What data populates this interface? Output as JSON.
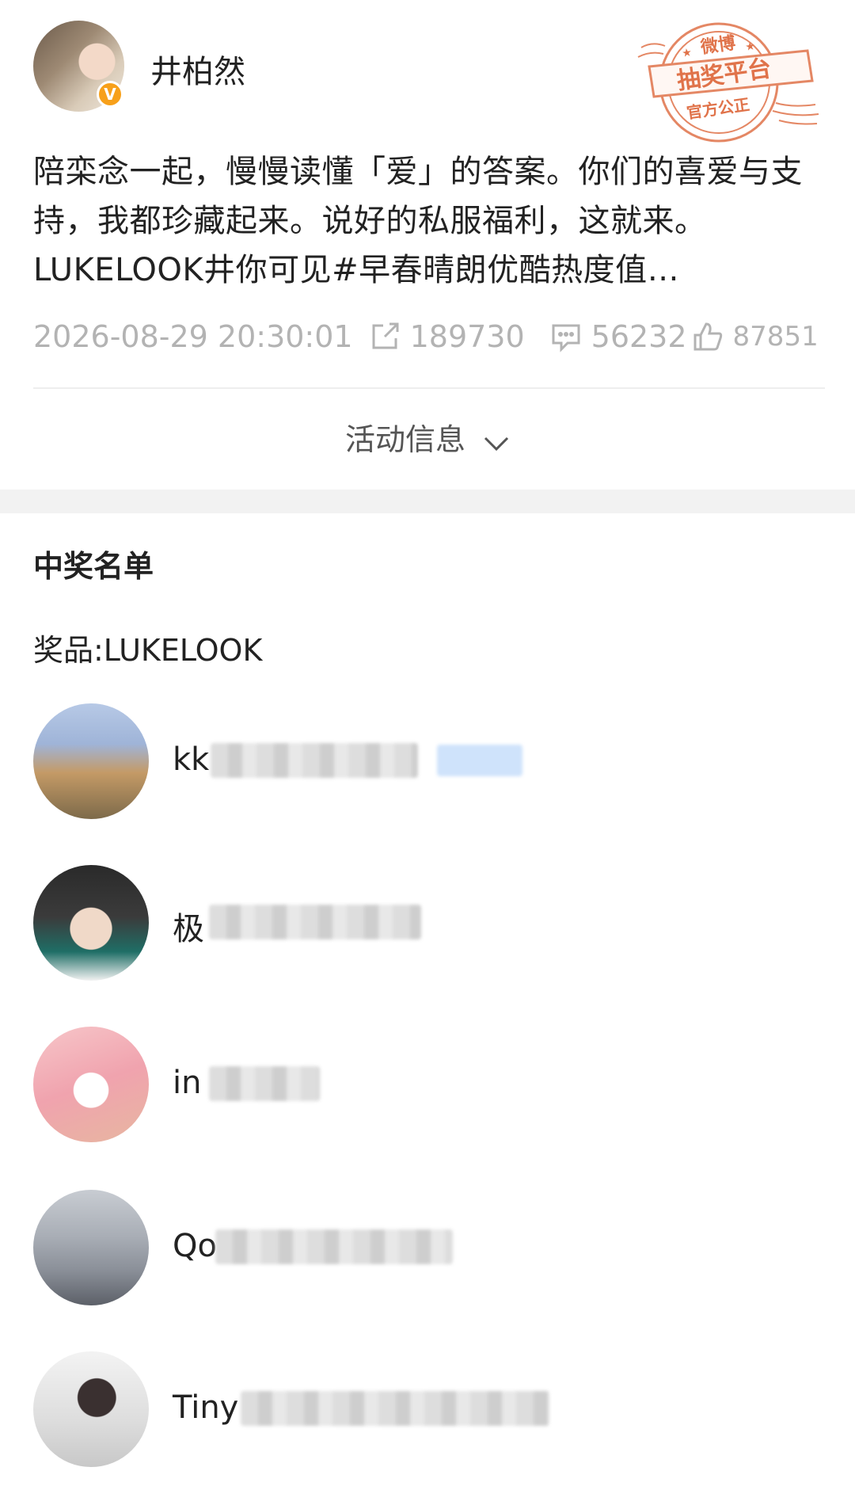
{
  "post": {
    "author": "井柏然",
    "verified_badge": "V",
    "text": "陪栾念一起，慢慢读懂「爱」的答案。你们的喜爱与支持，我都珍藏起来。说好的私服福利，这就来。LUKELOOK井你可见#早春晴朗优酷热度值…",
    "timestamp": "2026-08-29 20:30:01",
    "reposts": "189730",
    "comments": "56232",
    "likes": "87851",
    "activity_info_label": "活动信息"
  },
  "stamp": {
    "top": "微博",
    "middle": "抽奖平台",
    "bottom": "官方公正"
  },
  "winners": {
    "title": "中奖名单",
    "prize": "奖品:LUKELOOK",
    "list": [
      {
        "name": "kk"
      },
      {
        "name": "极"
      },
      {
        "name": "in"
      },
      {
        "name": "Qo"
      },
      {
        "name": "Tiny"
      }
    ]
  },
  "icons": [
    "repost-icon",
    "comment-icon",
    "like-icon",
    "chevron-down-icon"
  ],
  "colors": {
    "stamp": "#e0734a",
    "badge": "#f7a01a",
    "meta_text": "#b3b3b3"
  }
}
